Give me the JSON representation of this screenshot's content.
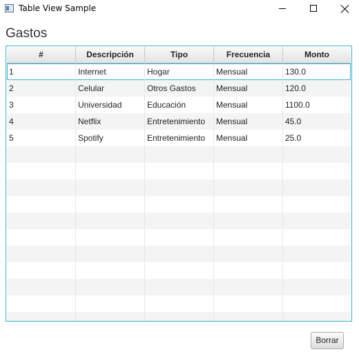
{
  "window": {
    "title": "Table View Sample"
  },
  "header": {
    "title": "Gastos"
  },
  "table": {
    "columns": [
      "#",
      "Descripción",
      "Tipo",
      "Frecuencia",
      "Monto"
    ],
    "rows": [
      [
        "1",
        "Internet",
        "Hogar",
        "Mensual",
        "130.0"
      ],
      [
        "2",
        "Celular",
        "Otros Gastos",
        "Mensual",
        "120.0"
      ],
      [
        "3",
        "Universidad",
        "Educación",
        "Mensual",
        "1100.0"
      ],
      [
        "4",
        "Netflix",
        "Entretenimiento",
        "Mensual",
        "45.0"
      ],
      [
        "5",
        "Spotify",
        "Entretenimiento",
        "Mensual",
        "25.0"
      ]
    ],
    "selected_row": 0,
    "accent_color": "#3bb0d6"
  },
  "actions": {
    "delete_label": "Borrar"
  }
}
